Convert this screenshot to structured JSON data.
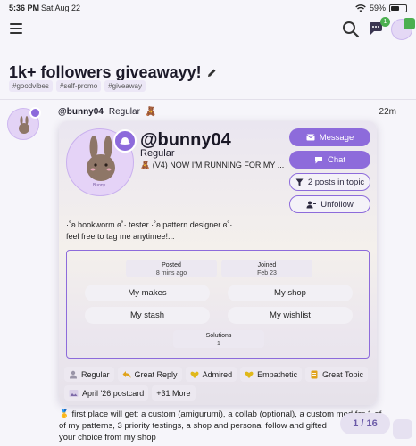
{
  "status_bar": {
    "time": "5:36 PM",
    "date": "Sat Aug 22",
    "battery": "59%",
    "battery_level": 0.59
  },
  "header": {
    "notifications_count": "1"
  },
  "topic": {
    "title": "1k+ followers giveawayy!",
    "tags": [
      "#goodvibes",
      "#self-promo",
      "#giveaway"
    ]
  },
  "post": {
    "username": "@bunny04",
    "user_title": "Regular",
    "time": "22m",
    "body_line1": "🥇 first place will get: a custom (amigurumi), a collab (optional), a custom mod for 1 of",
    "body_line2": "of my patterns, 3 priority testings, a shop and personal follow and gifted ",
    "body_line3": "your choice from my shop"
  },
  "pagination": {
    "label": "1 / 16"
  },
  "card": {
    "avatar_label": "Bunny",
    "username": "@bunny04",
    "title": "Regular",
    "status": "🧸 (V4) NOW I'M RUNNING FOR MY ...",
    "buttons": {
      "message": "Message",
      "chat": "Chat",
      "posts_in_topic": "2 posts in topic",
      "unfollow": "Unfollow"
    },
    "bio_line1": "·˚ʚ bookworm ɞ˚· tester ·˚ʚ pattern designer ɞ˚·",
    "bio_line2": "feel free to tag me anytimee!...",
    "stats": {
      "posted_label": "Posted",
      "posted_value": "8 mins ago",
      "joined_label": "Joined",
      "joined_value": "Feb 23",
      "solutions_label": "Solutions",
      "solutions_value": "1"
    },
    "links": {
      "my_makes": "My makes",
      "my_shop": "My shop",
      "my_stash": "My stash",
      "my_wishlist": "My wishlist"
    },
    "badges": {
      "regular": "Regular",
      "great_reply": "Great Reply",
      "admired": "Admired",
      "empathetic": "Empathetic",
      "great_topic": "Great Topic",
      "postcard": "April '26 postcard",
      "more": "+31 More"
    }
  },
  "colors": {
    "accent": "#8d6bdb",
    "badge_bg": "#ece8f0",
    "green": "#4caf50"
  }
}
